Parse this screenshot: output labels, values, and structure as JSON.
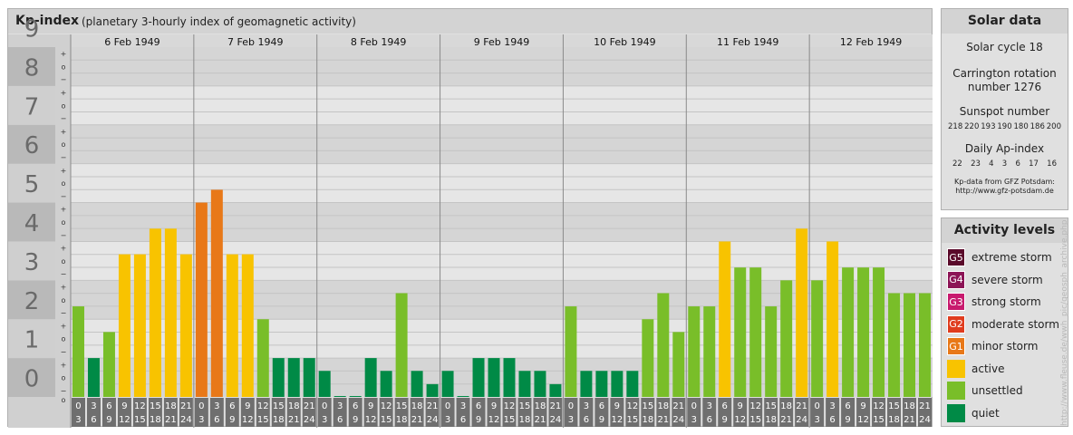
{
  "header": {
    "title": "Kp-index",
    "subtitle": "(planetary 3-hourly index of geomagnetic activity)"
  },
  "solar": {
    "title": "Solar data",
    "cycle": "Solar cycle 18",
    "carrington_line1": "Carrington rotation",
    "carrington_line2": "number 1276",
    "sunspot_title": "Sunspot number",
    "sunspot_values": [
      "218",
      "220",
      "193",
      "190",
      "180",
      "186",
      "200"
    ],
    "ap_title": "Daily Ap-index",
    "ap_values": [
      "22",
      "23",
      "4",
      "3",
      "6",
      "17",
      "16"
    ],
    "credit_line1": "Kp-data from GFZ Potsdam:",
    "credit_line2": "http://www.gfz-potsdam.de"
  },
  "activity": {
    "title": "Activity levels",
    "levels": [
      {
        "badge": "G5",
        "label": "extreme storm",
        "color": "#5a0a2a"
      },
      {
        "badge": "G4",
        "label": "severe storm",
        "color": "#8c1456"
      },
      {
        "badge": "G3",
        "label": "strong storm",
        "color": "#c81a6e"
      },
      {
        "badge": "G2",
        "label": "moderate storm",
        "color": "#e03c1e"
      },
      {
        "badge": "G1",
        "label": "minor storm",
        "color": "#e87818"
      },
      {
        "badge": "",
        "label": "active",
        "color": "#f8c300"
      },
      {
        "badge": "",
        "label": "unsettled",
        "color": "#79be29"
      },
      {
        "badge": "",
        "label": "quiet",
        "color": "#008a46"
      }
    ]
  },
  "watermark": "http://www.fleuse.de/wwh_pic/geosph_archive.php",
  "chart_data": {
    "type": "bar",
    "title": "Kp-index",
    "ylim": [
      0,
      9
    ],
    "y_ticks": [
      "0",
      "1",
      "2",
      "3",
      "4",
      "5",
      "6",
      "7",
      "8",
      "9"
    ],
    "sub_ticks": [
      "+",
      "o",
      "−"
    ],
    "days": [
      "6 Feb 1949",
      "7 Feb 1949",
      "8 Feb 1949",
      "9 Feb 1949",
      "10 Feb 1949",
      "11 Feb 1949",
      "12 Feb 1949"
    ],
    "interval_top": [
      "0",
      "3",
      "6",
      "9",
      "12",
      "15",
      "18",
      "21"
    ],
    "interval_bottom": [
      "3",
      "6",
      "9",
      "12",
      "15",
      "18",
      "21",
      "24"
    ],
    "values": [
      2.33,
      1.0,
      1.67,
      3.67,
      3.67,
      4.33,
      4.33,
      3.67,
      5.0,
      5.33,
      3.67,
      3.67,
      2.0,
      1.0,
      1.0,
      1.0,
      0.67,
      0.0,
      0.0,
      1.0,
      0.67,
      2.67,
      0.67,
      0.33,
      0.67,
      0.0,
      1.0,
      1.0,
      1.0,
      0.67,
      0.67,
      0.33,
      2.33,
      0.67,
      0.67,
      0.67,
      0.67,
      2.0,
      2.67,
      1.67,
      2.33,
      2.33,
      4.0,
      3.33,
      3.33,
      2.33,
      3.0,
      4.33,
      3.0,
      4.0,
      3.33,
      3.33,
      3.33,
      2.67,
      2.67,
      2.67
    ],
    "colors": {
      "quiet": "#008a46",
      "unsettled": "#79be29",
      "active": "#f8c300",
      "minor": "#e87818",
      "moderate": "#e03c1e"
    },
    "grid": true
  }
}
